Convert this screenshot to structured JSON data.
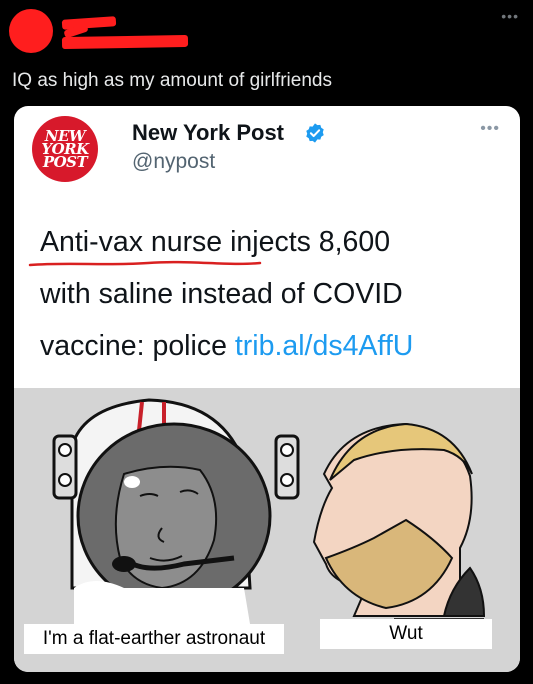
{
  "tweet": {
    "caption": "IQ as high as my amount of girlfriends",
    "more_icon": "more-horizontal-icon"
  },
  "embedded_tweet": {
    "account_name": "New York Post",
    "handle": "@nypost",
    "logo_text": [
      "NEW",
      "YORK",
      "POST"
    ],
    "verified_icon": "verified-badge-icon",
    "lines": [
      "Anti-vax nurse injects 8,600",
      "with saline instead of COVID",
      "vaccine: police "
    ],
    "link": "trib.al/ds4AffU"
  },
  "meme": {
    "left_caption": "I'm a flat-earther astronaut",
    "right_caption": "Wut"
  },
  "colors": {
    "background": "#000000",
    "redaction": "#ff1e1e",
    "nyp_red": "#d7192b",
    "link_blue": "#1d9bf0",
    "meme_bg": "#d4d4d4"
  }
}
